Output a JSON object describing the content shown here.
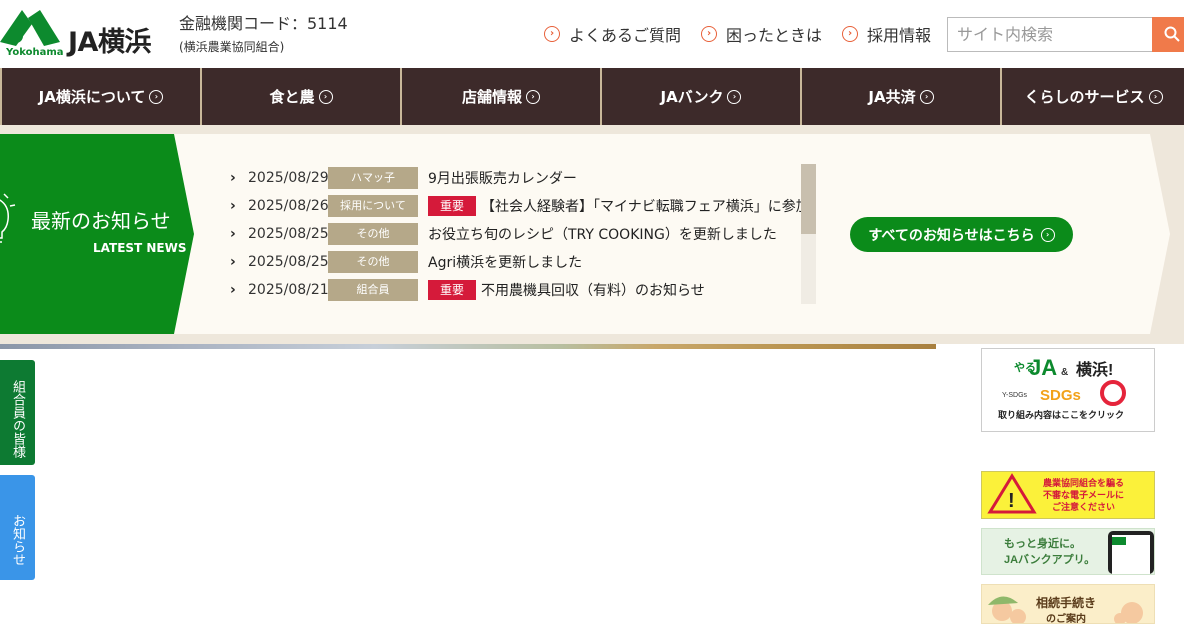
{
  "header": {
    "logo_text": "JA横浜",
    "logo_sub": "Yokohama",
    "code": "金融機関コード：5114",
    "org": "(横浜農業協同組合)",
    "links": [
      "よくあるご質問",
      "困ったときは",
      "採用情報"
    ],
    "search_placeholder": "サイト内検索"
  },
  "nav": [
    "JA横浜について",
    "食と農",
    "店舗情報",
    "JAバンク",
    "JA共済",
    "くらしのサービス"
  ],
  "news": {
    "title": "最新のお知らせ",
    "subtitle": "LATEST NEWS",
    "items": [
      {
        "date": "2025/08/29",
        "category": "ハマッ子",
        "important": "",
        "title": "9月出張販売カレンダー"
      },
      {
        "date": "2025/08/26",
        "category": "採用について",
        "important": "重要",
        "title": "【社会人経験者】「マイナビ転職フェア横浜」に参加"
      },
      {
        "date": "2025/08/25",
        "category": "その他",
        "important": "",
        "title": "お役立ち旬のレシピ（TRY COOKING）を更新しました"
      },
      {
        "date": "2025/08/25",
        "category": "その他",
        "important": "",
        "title": "Agri横浜を更新しました"
      },
      {
        "date": "2025/08/21",
        "category": "組合員",
        "important": "重要",
        "title": "不用農機具回収（有料）のお知らせ"
      }
    ],
    "all_button": "すべてのお知らせはこちら"
  },
  "side_tabs": {
    "members": "組合員の皆様",
    "news": "お知らせ"
  },
  "banners": {
    "sdgs": {
      "top": "やる",
      "brand": "JA",
      "and": "&",
      "city": "横浜!",
      "label": "Y-SDGs",
      "sdgs": "SDGs",
      "caption": "取り組み内容はここをクリック"
    },
    "warn": {
      "text1": "農業協同組合を騙る",
      "text2": "不審な電子メールに",
      "text3": "ご注意ください"
    },
    "app": {
      "text1": "もっと身近に。",
      "text2": "JAバンクアプリ。"
    },
    "inherit": {
      "text1": "相続手続き",
      "text2": "のご案内"
    }
  },
  "colors": {
    "green": "#0b8b1a",
    "nav": "#3d2a2a",
    "accent": "#f07a4a",
    "important": "#d51a3a",
    "category": "#b5a889"
  }
}
